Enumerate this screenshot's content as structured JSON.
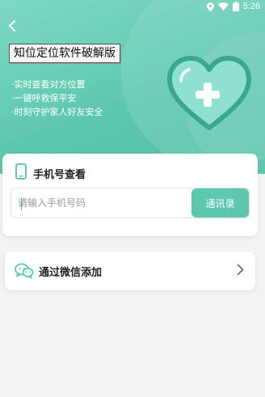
{
  "status_bar": {
    "time": "5:26"
  },
  "header": {
    "title": "知位定位软件破解版",
    "features": [
      "·实时查看对方位置",
      "·一键呼救保平安",
      "·时刻守护家人好友安全"
    ]
  },
  "phone_card": {
    "title": "手机号查看",
    "input_value": "",
    "input_placeholder": "请输入手机号码",
    "contacts_button": "通讯录"
  },
  "wechat_card": {
    "label": "通过微信添加"
  },
  "colors": {
    "accent": "#5ec8ae",
    "heart": "#7fd9c4",
    "heart_border": "#3aa88e"
  }
}
